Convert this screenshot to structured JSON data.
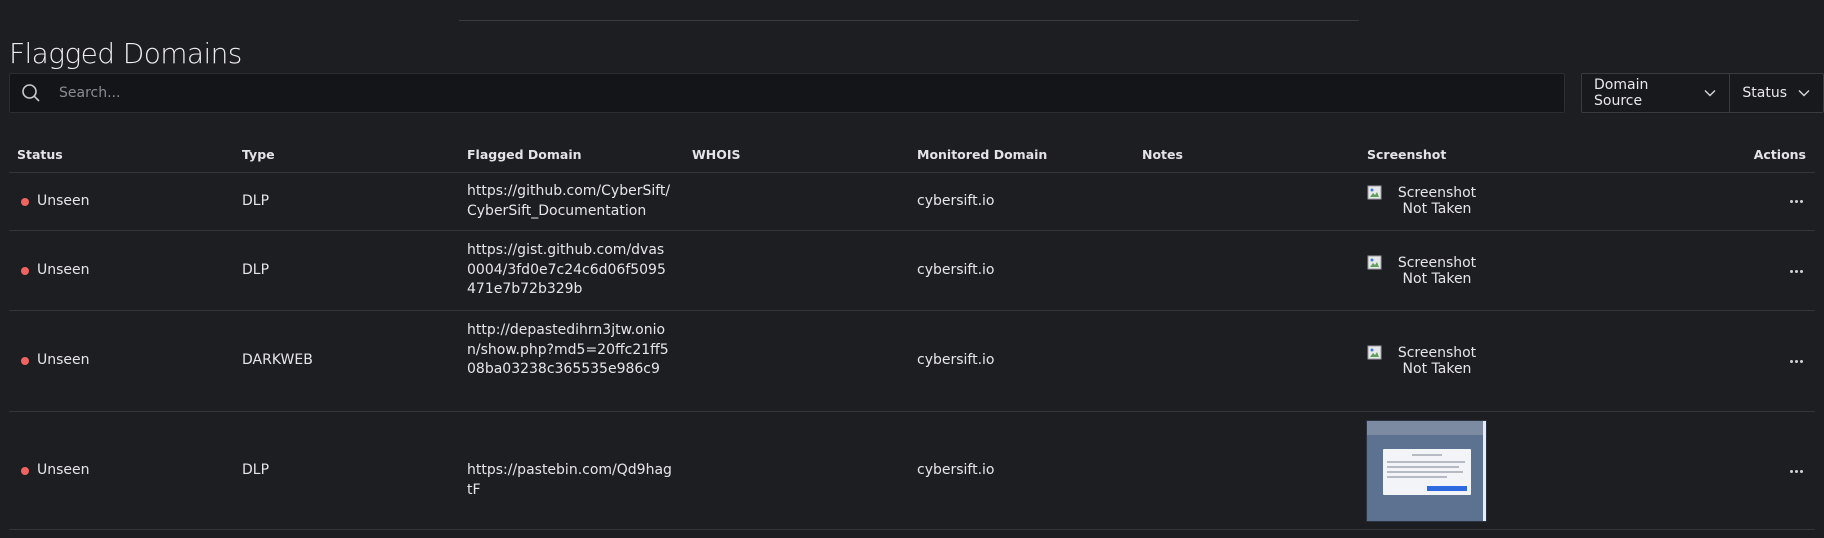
{
  "page": {
    "title": "Flagged Domains"
  },
  "search": {
    "placeholder": "Search..."
  },
  "filters": {
    "domain_source": "Domain Source",
    "status": "Status"
  },
  "table": {
    "headers": {
      "status": "Status",
      "type": "Type",
      "flagged_domain": "Flagged Domain",
      "whois": "WHOIS",
      "monitored_domain": "Monitored Domain",
      "notes": "Notes",
      "screenshot": "Screenshot",
      "actions": "Actions"
    },
    "rows": [
      {
        "status": "Unseen",
        "type": "DLP",
        "flagged_domain": "https://github.com/CyberSift/CyberSift_Documentation",
        "whois": "",
        "monitored_domain": "cybersift.io",
        "notes": "",
        "screenshot": "Screenshot Not Taken"
      },
      {
        "status": "Unseen",
        "type": "DLP",
        "flagged_domain": "https://gist.github.com/dvas0004/3fd0e7c24c6d06f5095471e7b72b329b",
        "whois": "",
        "monitored_domain": "cybersift.io",
        "notes": "",
        "screenshot": "Screenshot Not Taken"
      },
      {
        "status": "Unseen",
        "type": "DARKWEB",
        "flagged_domain": "http://depastedihrn3jtw.onion/show.php?md5=20ffc21ff508ba03238c365535e986c9",
        "whois": "",
        "monitored_domain": "cybersift.io",
        "notes": "",
        "screenshot": "Screenshot Not Taken"
      },
      {
        "status": "Unseen",
        "type": "DLP",
        "flagged_domain": "https://pastebin.com/Qd9hagtF",
        "whois": "",
        "monitored_domain": "cybersift.io",
        "notes": "",
        "screenshot": ""
      }
    ]
  },
  "colors": {
    "background": "#1d1e22",
    "status_unseen": "#ef6461",
    "border": "#34353b"
  },
  "icons": {
    "search": "search-icon",
    "dropdown": "chevron-down-icon",
    "actions": "more-horizontal-icon",
    "broken_image": "broken-image-icon"
  }
}
